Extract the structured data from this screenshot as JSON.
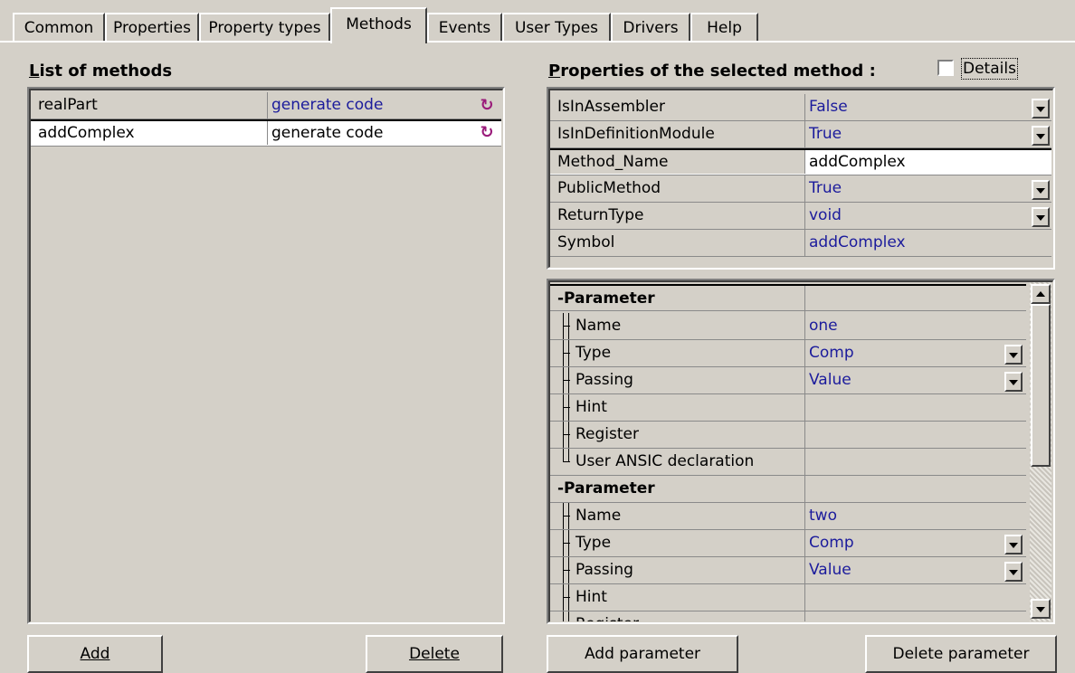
{
  "tabs": [
    "Common",
    "Properties",
    "Property types",
    "Methods",
    "Events",
    "User Types",
    "Drivers",
    "Help"
  ],
  "active_tab": "Methods",
  "methods_panel": {
    "title_prefix": "L",
    "title_rest": "ist of methods",
    "methods": [
      {
        "name": "realPart",
        "action": "generate code"
      },
      {
        "name": "addComplex",
        "action": "generate code"
      }
    ],
    "add_label": "Add",
    "delete_label": "Delete"
  },
  "properties_panel": {
    "title_prefix": "P",
    "title_rest": "roperties of the selected method :",
    "details_label": "Details",
    "details_checked": false,
    "properties": [
      {
        "name": "IsInAssembler",
        "value": "False",
        "dropdown": true
      },
      {
        "name": "IsInDefinitionModule",
        "value": "True",
        "dropdown": true
      },
      {
        "name": "Method_Name",
        "value": "addComplex",
        "dropdown": false
      },
      {
        "name": "PublicMethod",
        "value": "True",
        "dropdown": true
      },
      {
        "name": "ReturnType",
        "value": "void",
        "dropdown": true
      },
      {
        "name": "Symbol",
        "value": "addComplex",
        "dropdown": false
      }
    ]
  },
  "parameters_panel": {
    "group_label": "-Parameter",
    "parameters": [
      [
        {
          "name": "Name",
          "value": "one",
          "dropdown": false
        },
        {
          "name": "Type",
          "value": "Comp",
          "dropdown": true
        },
        {
          "name": "Passing",
          "value": "Value",
          "dropdown": true
        },
        {
          "name": "Hint",
          "value": "",
          "dropdown": false
        },
        {
          "name": "Register",
          "value": "",
          "dropdown": false
        },
        {
          "name": "User ANSIC declaration",
          "value": "",
          "dropdown": false
        }
      ],
      [
        {
          "name": "Name",
          "value": "two",
          "dropdown": false
        },
        {
          "name": "Type",
          "value": "Comp",
          "dropdown": true
        },
        {
          "name": "Passing",
          "value": "Value",
          "dropdown": true
        },
        {
          "name": "Hint",
          "value": "",
          "dropdown": false
        },
        {
          "name": "Register",
          "value": "",
          "dropdown": false
        }
      ]
    ],
    "add_param_label": "Add parameter",
    "delete_param_label": "Delete parameter"
  },
  "colors": {
    "background": "#d4d0c8",
    "value_text": "#1b1b9c",
    "generate_icon": "#9a1b7a"
  }
}
